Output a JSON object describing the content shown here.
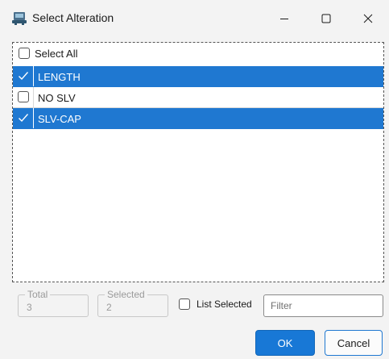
{
  "window": {
    "title": "Select Alteration",
    "icon": "app-icon",
    "controls": [
      "minimize-icon",
      "maximize-icon",
      "close-icon"
    ]
  },
  "list": {
    "select_all": {
      "label": "Select All",
      "checked": false
    },
    "items": [
      {
        "label": "LENGTH",
        "checked": true,
        "selected": true
      },
      {
        "label": "NO SLV",
        "checked": false,
        "selected": false
      },
      {
        "label": "SLV-CAP",
        "checked": true,
        "selected": true
      }
    ]
  },
  "counts": {
    "total_label": "Total",
    "total_value": "3",
    "selected_label": "Selected",
    "selected_value": "2"
  },
  "list_selected": {
    "label": "List Selected",
    "checked": false
  },
  "filter": {
    "placeholder": "Filter",
    "value": ""
  },
  "buttons": {
    "ok": "OK",
    "cancel": "Cancel"
  },
  "colors": {
    "selection": "#1f78d1",
    "ok_button": "#1878d6"
  }
}
